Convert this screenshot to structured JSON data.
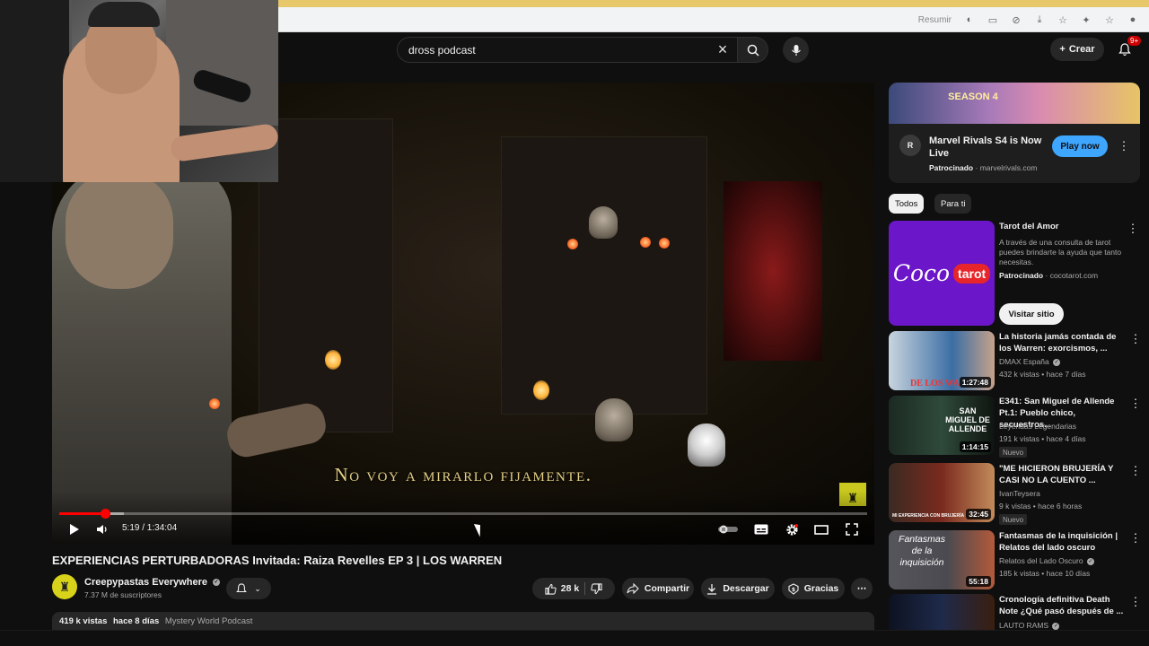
{
  "browser": {
    "resume_label": "Resumir",
    "icons": [
      "translate-icon",
      "screen-icon",
      "eye-off-icon",
      "download-icon",
      "star-icon",
      "extensions-icon",
      "bookmark-icon",
      "profile-icon"
    ]
  },
  "header": {
    "search_value": "dross podcast",
    "create_label": "Crear",
    "notif_badge": "9+"
  },
  "player": {
    "subtitle": "No voy a mirarlo fijamente.",
    "time": "5:19 / 1:34:04",
    "progress_fraction": 0.0565,
    "loaded_fraction": 0.08
  },
  "video": {
    "title": "EXPERIENCIAS PERTURBADORAS Invitada: Raiza Revelles EP 3 | LOS WARREN",
    "channel": "Creepypastas Everywhere",
    "subscribers": "7.37 M de suscriptores",
    "likes": "28 k",
    "share_label": "Compartir",
    "download_label": "Descargar",
    "thanks_label": "Gracias",
    "views": "419 k vistas",
    "age": "hace 8 días",
    "tag": "Mystery World Podcast"
  },
  "ad": {
    "banner_text": "SEASON 4",
    "title": "Marvel Rivals S4 is Now Live",
    "sponsored": "Patrocinado",
    "domain": "marvelrivals.com",
    "cta": "Play now"
  },
  "chips": [
    "Todos",
    "Para ti"
  ],
  "tarot_ad": {
    "thumb_word1": "Coco",
    "thumb_word2": "tarot",
    "title": "Tarot del Amor",
    "desc": "A través de una consulta de tarot puedes brindarte la ayuda que tanto necesitas.",
    "sponsored": "Patrocinado",
    "domain": "cocotarot.com",
    "cta": "Visitar sitio"
  },
  "related": [
    {
      "title": "La historia jamás contada de los Warren: exorcismos, ...",
      "channel": "DMAX España",
      "meta": "432 k vistas • hace 7 días",
      "duration": "1:27:48",
      "badge": "",
      "color": "#3b6ea5"
    },
    {
      "title": "E341: San Miguel de Allende Pt.1: Pueblo chico, secuestros...",
      "channel": "Leyendas Legendarias",
      "meta": "191 k vistas • hace 4 días",
      "duration": "1:14:15",
      "badge": "Nuevo",
      "color": "#2e4a3a"
    },
    {
      "title": "\"ME HICIERON BRUJERÍA Y CASI NO LA CUENTO ...",
      "channel": "IvanTeysera",
      "meta": "9 k vistas • hace 6 horas",
      "duration": "32:45",
      "badge": "Nuevo",
      "color": "#7a2a1e"
    },
    {
      "title": "Fantasmas de la inquisición | Relatos del lado oscuro",
      "channel": "Relatos del Lado Oscuro",
      "meta": "185 k vistas • hace 10 días",
      "duration": "55:18",
      "badge": "",
      "color": "#4a4a50"
    },
    {
      "title": "Cronología definitiva Death Note ¿Qué pasó después de ...",
      "channel": "LAUTO RAMS",
      "meta": "",
      "duration": "",
      "badge": "",
      "color": "#1e2a4a"
    }
  ],
  "thumb_texts": [
    "DE LOS WA",
    "SAN MIGUEL DE ALLENDE",
    "MI EXPERIENCIA CON BRUJERÍA",
    "Fantasmas de la inquisición"
  ]
}
